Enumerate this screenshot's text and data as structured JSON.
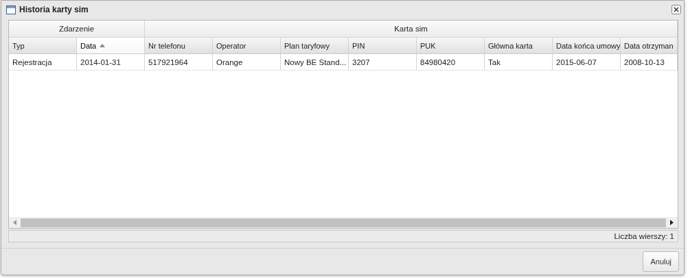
{
  "window": {
    "title": "Historia karty sim"
  },
  "table": {
    "groups": [
      {
        "label": "Zdarzenie",
        "columns": [
          {
            "label": "Typ",
            "sorted": false
          },
          {
            "label": "Data",
            "sorted": true
          }
        ]
      },
      {
        "label": "Karta sim",
        "columns": [
          {
            "label": "Nr telefonu",
            "sorted": false
          },
          {
            "label": "Operator",
            "sorted": false
          },
          {
            "label": "Plan taryfowy",
            "sorted": false
          },
          {
            "label": "PIN",
            "sorted": false
          },
          {
            "label": "PUK",
            "sorted": false
          },
          {
            "label": "Główna karta",
            "sorted": false
          },
          {
            "label": "Data końca umowy",
            "sorted": false
          },
          {
            "label": "Data otrzyman",
            "sorted": false
          }
        ]
      }
    ],
    "rows": [
      [
        "Rejestracja",
        "2014-01-31",
        "517921964",
        "Orange",
        "Nowy BE Stand...",
        "3207",
        "84980420",
        "Tak",
        "2015-06-07",
        "2008-10-13"
      ]
    ]
  },
  "status_bar": "Liczba wierszy: 1",
  "buttons": [
    "Anuluj"
  ]
}
